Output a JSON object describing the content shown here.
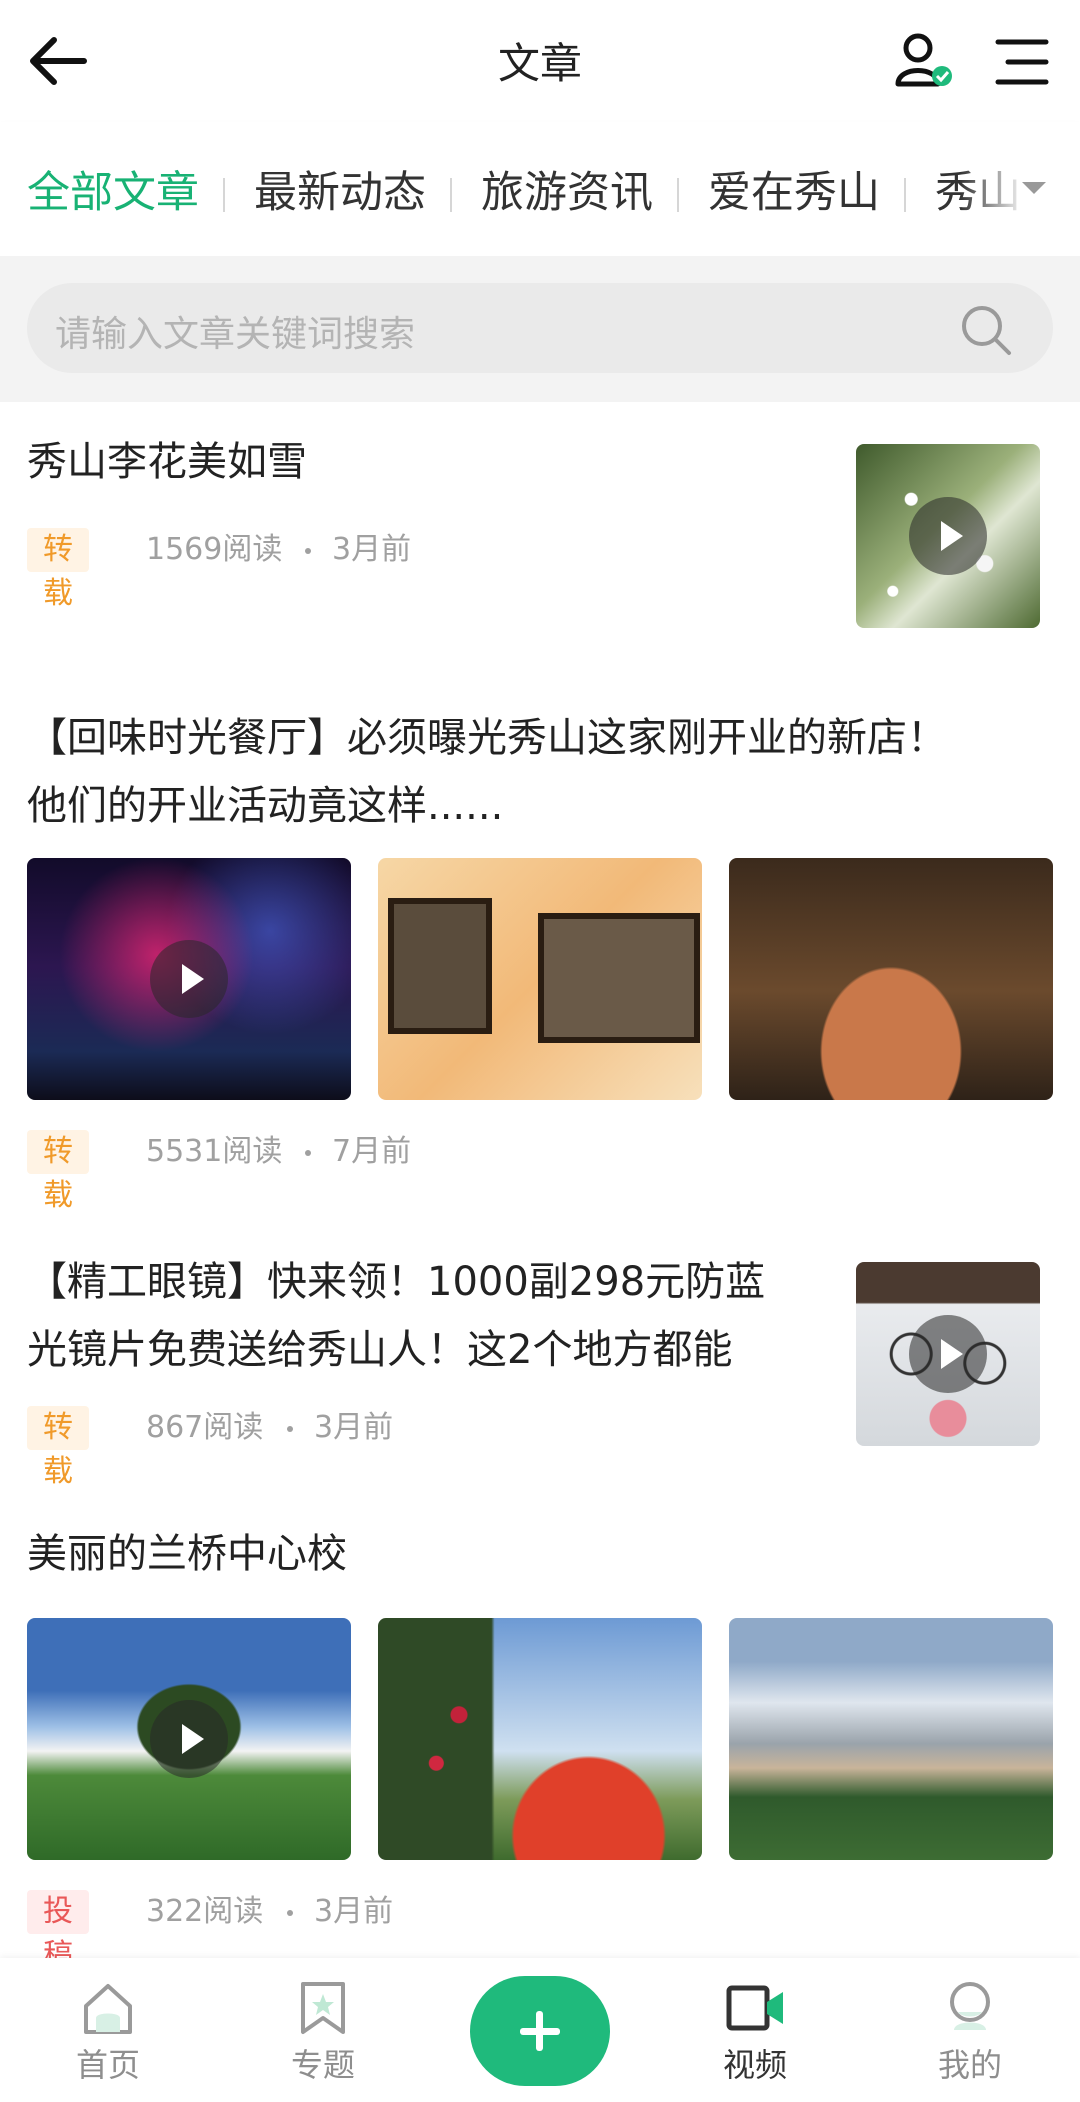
{
  "header": {
    "title": "文章"
  },
  "tabs": [
    "全部文章",
    "最新动态",
    "旅游资讯",
    "爱在秀山",
    "秀山"
  ],
  "search": {
    "placeholder": "请输入文章关键词搜索"
  },
  "articles": [
    {
      "title": "秀山李花美如雪",
      "badge": "转载",
      "reads": "1569阅读",
      "time": "3月前"
    },
    {
      "title_line1": "【回味时光餐厅】必须曝光秀山这家刚开业的新店！",
      "title_line2": "他们的开业活动竟这样......",
      "badge": "转载",
      "reads": "5531阅读",
      "time": "7月前"
    },
    {
      "title_line1": "【精工眼镜】快来领！1000副298元防蓝",
      "title_line2": "光镜片免费送给秀山人！这2个地方都能",
      "badge": "转载",
      "reads": "867阅读",
      "time": "3月前"
    },
    {
      "title": "美丽的兰桥中心校",
      "badge": "投稿",
      "reads": "322阅读",
      "time": "3月前"
    }
  ],
  "bottom_nav": [
    {
      "label": "首页",
      "icon": "home-icon"
    },
    {
      "label": "专题",
      "icon": "bookmark-icon"
    },
    {
      "label": "视频",
      "icon": "video-icon",
      "active": true
    },
    {
      "label": "我的",
      "icon": "profile-icon"
    }
  ],
  "colors": {
    "accent": "#18b274",
    "fab": "#1fba7c",
    "badge_orange": "#f09a2a",
    "badge_red": "#e95858"
  }
}
